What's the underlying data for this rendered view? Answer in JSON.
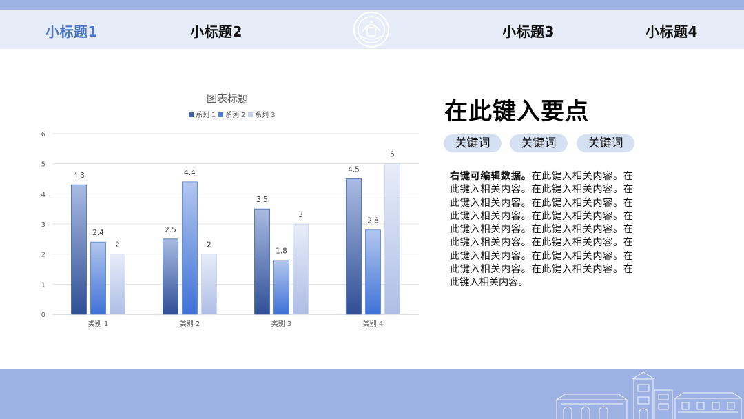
{
  "colors": {
    "accent": "#4a74c6",
    "header_band": "#9db1e3",
    "nav_background": "#e6ecf8",
    "pill_background": "#d6e0f3",
    "series_1": "#3f64a8",
    "series_2": "#4f7fd8",
    "series_3": "#c9d4ee"
  },
  "nav": {
    "items": [
      "小标题1",
      "小标题2",
      "小标题3",
      "小标题4"
    ],
    "active_index": 0,
    "logo_icon": "university-seal-icon"
  },
  "main": {
    "title": "在此键入要点",
    "keywords": [
      "关键词",
      "关键词",
      "关键词"
    ],
    "body_lead": "右键可编辑数据。",
    "body_text": "在此键入相关内容。在此键入相关内容。在此键入相关内容。在此键入相关内容。在此键入相关内容。在此键入相关内容。在此键入相关内容。在此键入相关内容。在此键入相关内容。在此键入相关内容。在此键入相关内容。在此键入相关内容。在此键入相关内容。在此键入相关内容。在此键入相关内容。在此键入相关内容。"
  },
  "footer": {
    "art_icon": "campus-building-icon"
  },
  "chart_data": {
    "type": "bar",
    "title": "图表标题",
    "categories": [
      "类别 1",
      "类别 2",
      "类别 3",
      "类别 4"
    ],
    "series": [
      {
        "name": "系列 1",
        "values": [
          4.3,
          2.5,
          3.5,
          4.5
        ]
      },
      {
        "name": "系列 2",
        "values": [
          2.4,
          4.4,
          1.8,
          2.8
        ]
      },
      {
        "name": "系列 3",
        "values": [
          2,
          2,
          3,
          5
        ]
      }
    ],
    "y_ticks": [
      "0",
      "1",
      "2",
      "3",
      "4",
      "5",
      "6"
    ],
    "ylim": [
      0,
      6
    ],
    "grid": true,
    "legend_position": "top",
    "data_labels": true
  }
}
